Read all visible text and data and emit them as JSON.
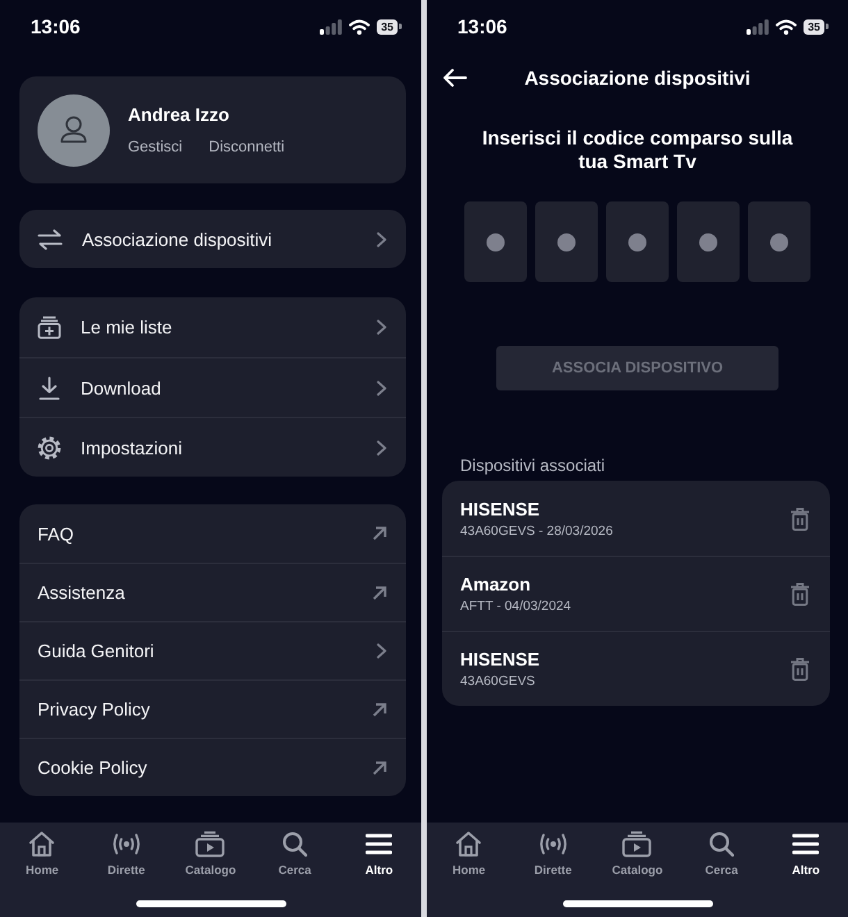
{
  "menu_screen": {
    "status_bar": {
      "time": "13:06",
      "battery": "35"
    },
    "profile": {
      "name": "Andrea Izzo",
      "actions": [
        "Gestisci",
        "Disconnetti"
      ]
    },
    "menu_groups": [
      {
        "items": [
          {
            "label": "Associazione dispositivi",
            "kind": "page"
          }
        ]
      },
      {
        "items": [
          {
            "label": "Le mie liste",
            "kind": "page"
          },
          {
            "label": "Download",
            "kind": "page"
          },
          {
            "label": "Impostazioni",
            "kind": "page"
          }
        ]
      },
      {
        "items": [
          {
            "label": "FAQ",
            "kind": "external"
          },
          {
            "label": "Assistenza",
            "kind": "external"
          },
          {
            "label": "Guida Genitori",
            "kind": "page"
          },
          {
            "label": "Privacy Policy",
            "kind": "external"
          },
          {
            "label": "Cookie Policy",
            "kind": "external"
          }
        ]
      }
    ],
    "tab_bar": [
      {
        "label": "Home",
        "selected": false
      },
      {
        "label": "Dirette",
        "selected": false
      },
      {
        "label": "Catalogo",
        "selected": false
      },
      {
        "label": "Cerca",
        "selected": false
      },
      {
        "label": "Altro",
        "selected": true
      }
    ]
  },
  "pairing_screen": {
    "status_bar": {
      "time": "13:06",
      "battery": "35"
    },
    "header": {
      "title": "Associazione dispositivi"
    },
    "instruction": "Inserisci il codice comparso sulla tua Smart Tv",
    "code_fields": [
      {
        "filled": false
      },
      {
        "filled": false
      },
      {
        "filled": false
      },
      {
        "filled": false
      },
      {
        "filled": false
      }
    ],
    "pair_button": {
      "label": "ASSOCIA DISPOSITIVO",
      "disabled": true
    },
    "devices_heading": "Dispositivi associati",
    "devices": [
      {
        "name": "HISENSE",
        "detail": "43A60GEVS - 28/03/2026"
      },
      {
        "name": "Amazon",
        "detail": "AFTT - 04/03/2024"
      },
      {
        "name": "HISENSE",
        "detail": "43A60GEVS"
      }
    ],
    "tab_bar": [
      {
        "label": "Home",
        "selected": false
      },
      {
        "label": "Dirette",
        "selected": false
      },
      {
        "label": "Catalogo",
        "selected": false
      },
      {
        "label": "Cerca",
        "selected": false
      },
      {
        "label": "Altro",
        "selected": true
      }
    ]
  }
}
